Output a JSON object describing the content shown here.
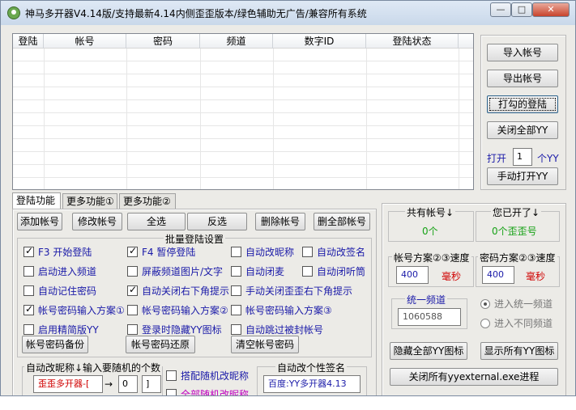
{
  "window": {
    "title": "神马多开器V4.14版/支持最新4.14内侧歪歪版本/绿色辅助无广告/兼容所有系统",
    "minimize": "—",
    "maximize": "□",
    "close": "✕"
  },
  "accounts_table": {
    "columns": [
      "登陆",
      "帐号",
      "密码",
      "频道",
      "数字ID",
      "登陆状态"
    ]
  },
  "right_panel": {
    "import_accounts": "导入帐号",
    "export_accounts": "导出帐号",
    "login_checked": "打勾的登陆",
    "close_all_yy": "关闭全部YY",
    "open_label": "打开",
    "open_count": "1",
    "open_unit": "个YY",
    "manual_open": "手动打开YY"
  },
  "tabs": [
    "登陆功能",
    "更多功能①",
    "更多功能②"
  ],
  "toolbar": {
    "add_account": "添加帐号",
    "edit_account": "修改帐号",
    "select_all": "全选",
    "invert": "反选",
    "delete_account": "删除帐号",
    "delete_all": "删全部帐号"
  },
  "batch_login": {
    "group_label": "批量登陆设置",
    "f3_start": "F3 开始登陆",
    "f4_pause": "F4 暂停登陆",
    "auto_rename": "自动改昵称",
    "auto_signature": "自动改签名",
    "enter_channel": "启动进入频道",
    "hide_channel_images": "屏蔽频道图片/文字",
    "auto_mute_mic": "自动闭麦",
    "auto_mute_listen": "自动闭听筒",
    "remember_password": "自动记住密码",
    "close_corner_tip": "自动关闭右下角提示",
    "manual_close_corner": "手动关闭歪歪右下角提示",
    "pwd_scheme1": "帐号密码输入方案①",
    "pwd_scheme2": "帐号密码输入方案②",
    "pwd_scheme3": "帐号密码输入方案③",
    "lite_yy": "启用精简版YY",
    "hide_icon_on_login": "登录时隐藏YY图标",
    "skip_blocked": "自动跳过被封帐号",
    "backup_passwords": "帐号密码备份",
    "restore_passwords": "帐号密码还原",
    "clear_passwords": "清空帐号密码"
  },
  "rename_area": {
    "group_label": "自动改昵称↓输入要随机的个数",
    "nickname_value": "歪歪多开器-[",
    "arrow": "→",
    "count_value": "0",
    "bracket": "]",
    "rename_random_check": "搭配随机改昵称",
    "all_random_check": "全部随机改昵称",
    "signature_group": "自动改个性签名",
    "signature_value": "百度:YY多开器4.13"
  },
  "stats": {
    "total_accounts_label": "共有帐号↓",
    "total_accounts_value": "0个",
    "opened_label": "您已开了↓",
    "opened_value": "0个歪歪号",
    "scheme23_label": "帐号方案②③速度",
    "scheme23_speed": "400",
    "scheme23_unit": "毫秒",
    "pwd_scheme23_label": "密码方案②③速度",
    "pwd_scheme23_speed": "400",
    "pwd_scheme23_unit": "毫秒",
    "unified_channel_label": "统一频道",
    "unified_channel_value": "1060588",
    "enter_unified": "进入统一频道",
    "enter_different": "进入不同频道",
    "hide_all_icons": "隐藏全部YY图标",
    "show_all_icons": "显示所有YY图标",
    "close_yyexternal": "关闭所有yyexternal.exe进程"
  },
  "colors": {
    "green": "#17a217",
    "red": "#d00000",
    "blue": "#1a1aa8"
  }
}
